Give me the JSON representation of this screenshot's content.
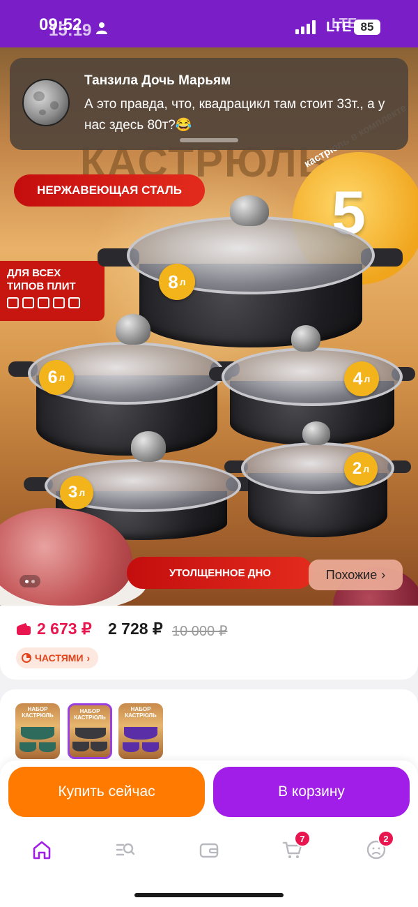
{
  "status_bar": {
    "time_primary": "09:52",
    "time_overlay": "15:19",
    "network_primary": "LTE",
    "network_overlay": "LTE",
    "battery": "85"
  },
  "notification": {
    "sender": "Танзила Дочь Марьям",
    "message": "А это правда, что, квадрацикл там стоит 33т., а у нас здесь 80т?😂"
  },
  "product_image": {
    "title_fragment": "КАСТРЮЛЬ",
    "badge_steel": "НЕРЖАВЕЮЩАЯ СТАЛЬ",
    "badge_stoves": "ДЛЯ ВСЕХ\nТИПОВ ПЛИТ",
    "promo_count": "5",
    "promo_text": "кастрюль в комплекте",
    "volumes": [
      {
        "value": "8",
        "unit": "л"
      },
      {
        "value": "6",
        "unit": "л"
      },
      {
        "value": "4",
        "unit": "л"
      },
      {
        "value": "3",
        "unit": "л"
      },
      {
        "value": "2",
        "unit": "л"
      }
    ],
    "badge_bottom": "УТОЛЩЕННОЕ ДНО",
    "similar_button": "Похожие",
    "similar_chevron": "›"
  },
  "price": {
    "wallet_price": "2 673 ₽",
    "regular_price": "2 728 ₽",
    "old_price": "10 000 ₽",
    "installments": "ЧАСТЯМИ",
    "installments_chevron": "›"
  },
  "variants": {
    "thumb_label": "НАБОР\nКАСТРЮЛЬ",
    "items": [
      {
        "pot_color": "#2f6b5c",
        "selected": false
      },
      {
        "pot_color": "#3a3a3e",
        "selected": true
      },
      {
        "pot_color": "#5a2ea6",
        "selected": false
      }
    ]
  },
  "actions": {
    "buy_now": "Купить сейчас",
    "add_to_cart": "В корзину"
  },
  "bottom_nav": {
    "items": [
      {
        "icon": "home-icon",
        "active": true
      },
      {
        "icon": "catalog-search-icon",
        "active": false
      },
      {
        "icon": "wallet-icon",
        "active": false
      },
      {
        "icon": "cart-icon",
        "badge": "7",
        "active": false
      },
      {
        "icon": "profile-icon",
        "badge": "2",
        "active": false
      }
    ]
  },
  "colors": {
    "brand_purple": "#7a1fc8",
    "buy_orange": "#ff7a00",
    "cart_purple": "#a11ee8",
    "price_pink": "#e8154f"
  }
}
